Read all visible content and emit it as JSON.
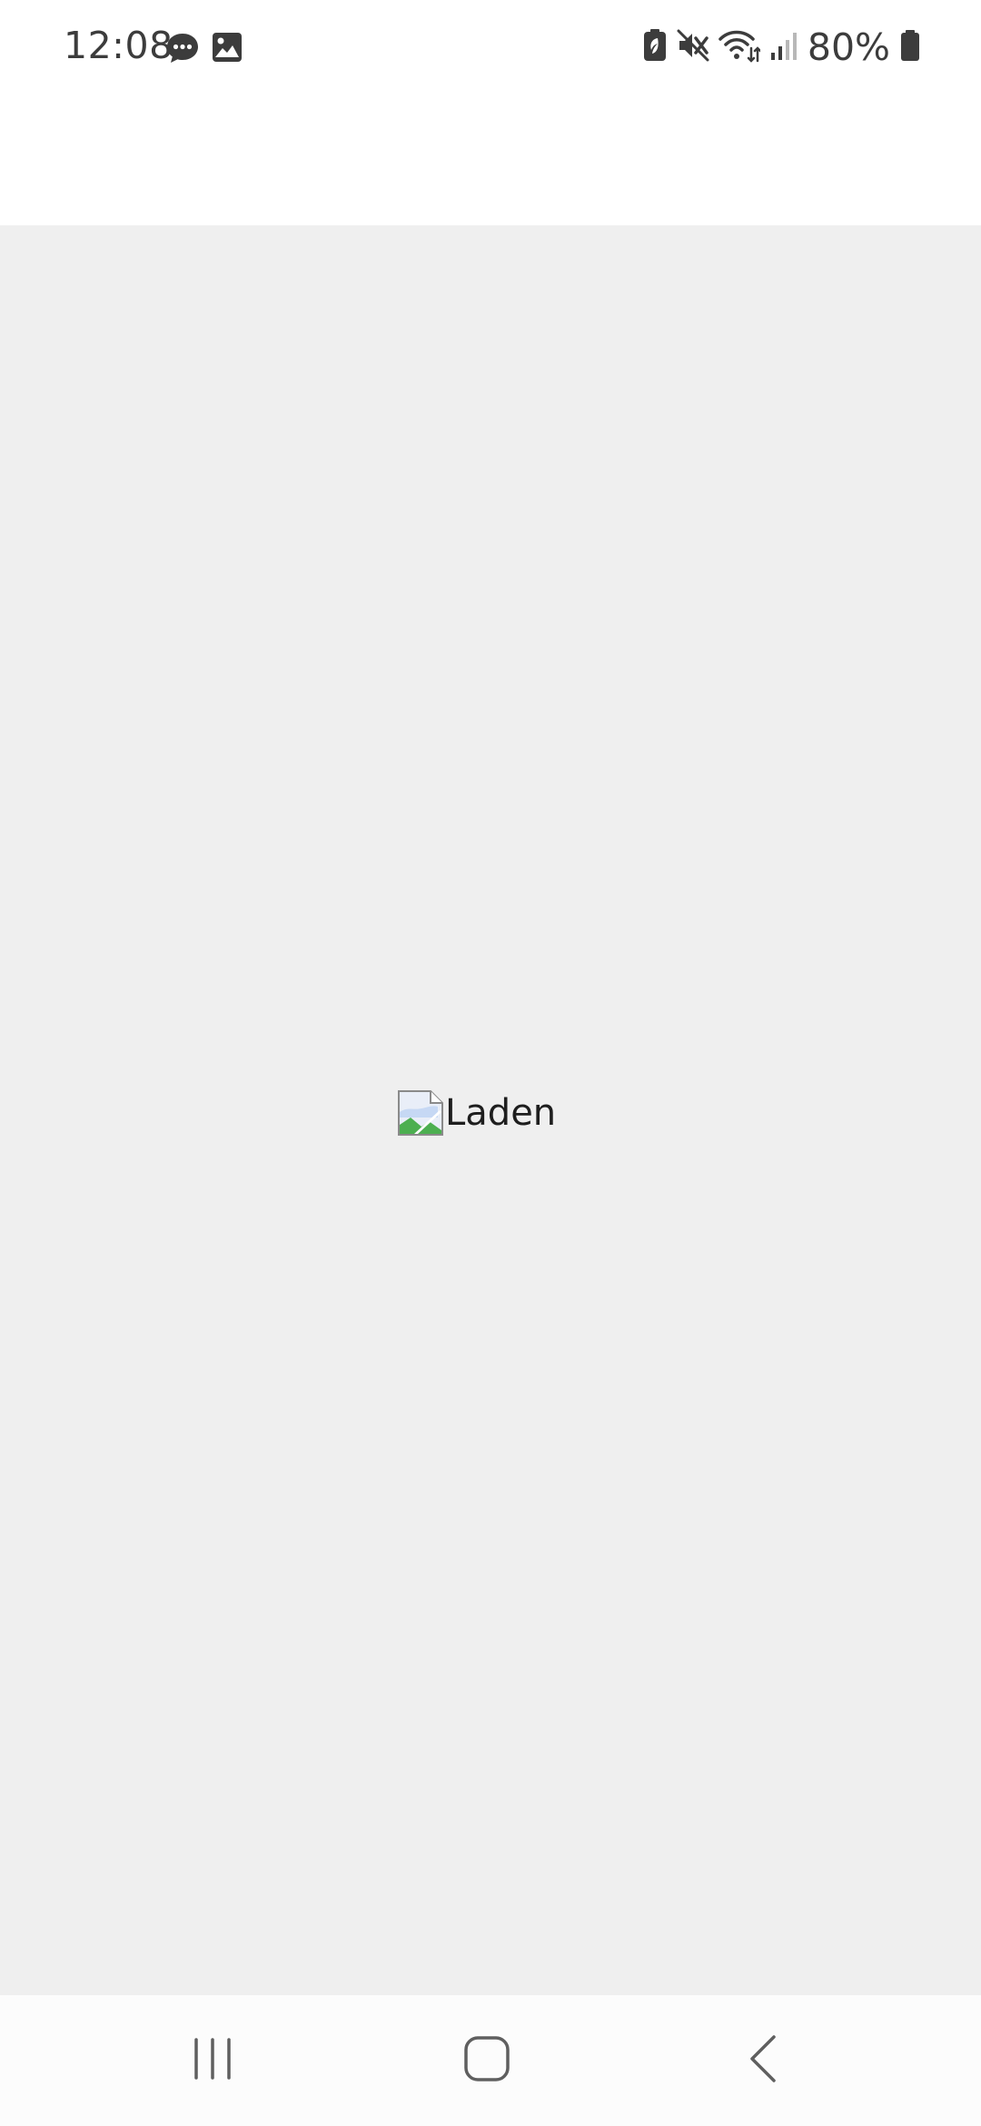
{
  "status_bar": {
    "time": "12:08",
    "battery_percent": "80%",
    "icons_left": [
      "chat-bubble-icon",
      "image-icon"
    ],
    "icons_right": [
      "battery-saver-icon",
      "mute-icon",
      "wifi-icon",
      "signal-icon",
      "battery-icon"
    ]
  },
  "content": {
    "loading_alt_text": "Laden"
  },
  "nav_bar": {
    "buttons": [
      "recent-apps",
      "home",
      "back"
    ]
  },
  "colors": {
    "content_bg": "#efefef",
    "status_text": "#3c3c3c",
    "nav_icon": "#5f5f5f"
  }
}
